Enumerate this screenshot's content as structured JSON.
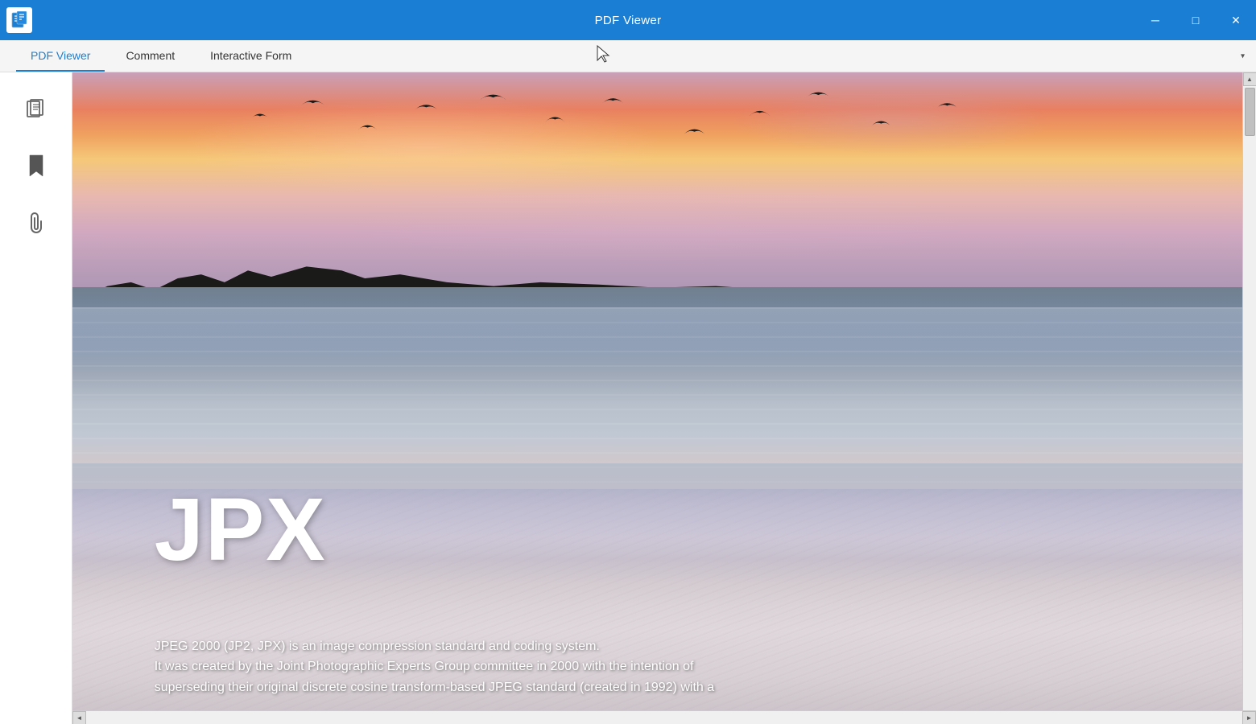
{
  "titlebar": {
    "title": "PDF Viewer",
    "minimize_label": "─",
    "maximize_label": "□",
    "close_label": "✕"
  },
  "tabs": [
    {
      "id": "pdf-viewer",
      "label": "PDF Viewer",
      "active": true
    },
    {
      "id": "comment",
      "label": "Comment",
      "active": false
    },
    {
      "id": "interactive-form",
      "label": "Interactive Form",
      "active": false
    }
  ],
  "sidebar": {
    "icons": [
      {
        "id": "pages-icon",
        "symbol": "⧉",
        "label": "Pages"
      },
      {
        "id": "bookmark-icon",
        "symbol": "🔖",
        "label": "Bookmarks"
      },
      {
        "id": "attachment-icon",
        "symbol": "📎",
        "label": "Attachments"
      }
    ]
  },
  "pdf_content": {
    "title": "JPX",
    "description_line1": "JPEG 2000 (JP2, JPX) is an image compression standard and coding system.",
    "description_line2": "It was created by the Joint Photographic Experts Group committee in 2000 with the intention of",
    "description_line3": "superseding their original discrete cosine transform-based JPEG standard (created in 1992) with a"
  },
  "colors": {
    "titlebar_bg": "#1a7fd4",
    "tab_active_color": "#1a7fd4",
    "tab_underline": "#1a7fd4"
  }
}
